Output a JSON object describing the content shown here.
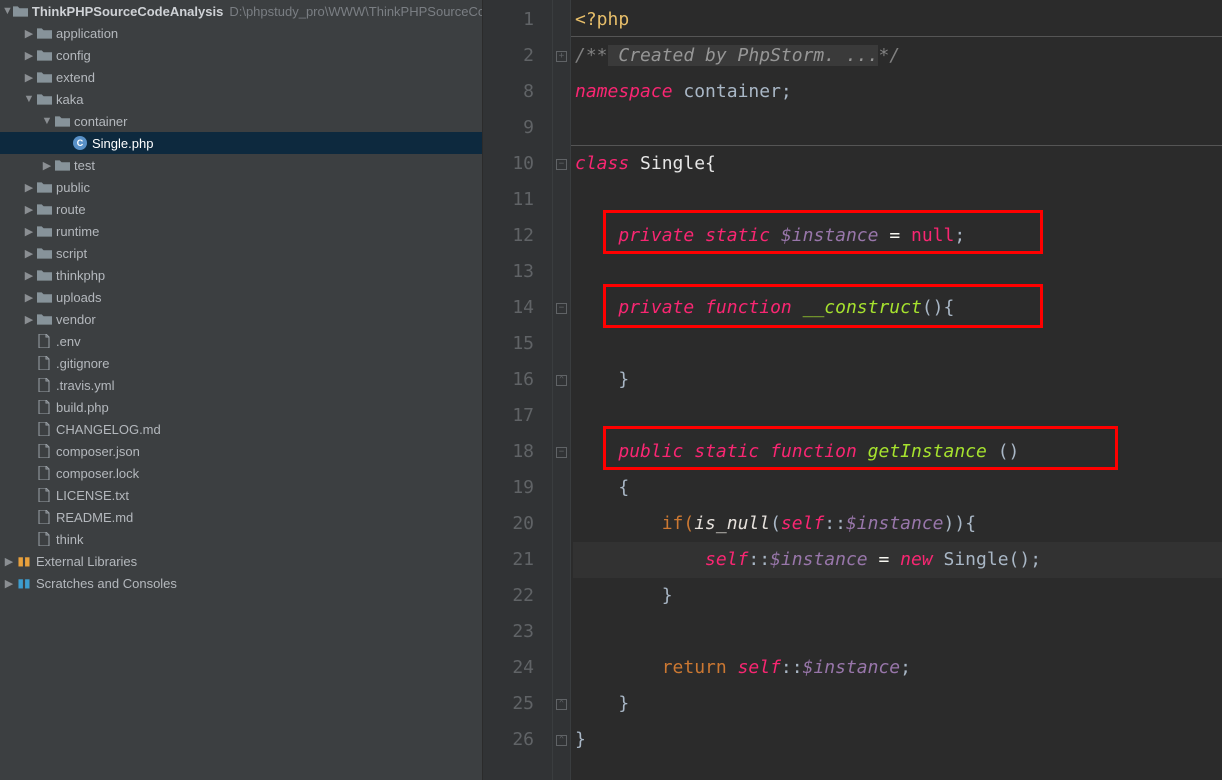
{
  "project": {
    "name": "ThinkPHPSourceCodeAnalysis",
    "path": "D:\\phpstudy_pro\\WWW\\ThinkPHPSourceCo"
  },
  "tree": [
    {
      "depth": 1,
      "arrow": "▶",
      "type": "folder",
      "label": "application"
    },
    {
      "depth": 1,
      "arrow": "▶",
      "type": "folder",
      "label": "config"
    },
    {
      "depth": 1,
      "arrow": "▶",
      "type": "folder",
      "label": "extend"
    },
    {
      "depth": 1,
      "arrow": "▼",
      "type": "folder",
      "label": "kaka"
    },
    {
      "depth": 2,
      "arrow": "▼",
      "type": "folder",
      "label": "container"
    },
    {
      "depth": 3,
      "arrow": "",
      "type": "php",
      "label": "Single.php",
      "selected": true
    },
    {
      "depth": 2,
      "arrow": "▶",
      "type": "folder",
      "label": "test"
    },
    {
      "depth": 1,
      "arrow": "▶",
      "type": "folder",
      "label": "public"
    },
    {
      "depth": 1,
      "arrow": "▶",
      "type": "folder",
      "label": "route"
    },
    {
      "depth": 1,
      "arrow": "▶",
      "type": "folder",
      "label": "runtime"
    },
    {
      "depth": 1,
      "arrow": "▶",
      "type": "folder",
      "label": "script"
    },
    {
      "depth": 1,
      "arrow": "▶",
      "type": "folder",
      "label": "thinkphp"
    },
    {
      "depth": 1,
      "arrow": "▶",
      "type": "folder",
      "label": "uploads"
    },
    {
      "depth": 1,
      "arrow": "▶",
      "type": "folder",
      "label": "vendor"
    },
    {
      "depth": 1,
      "arrow": "",
      "type": "file",
      "label": ".env"
    },
    {
      "depth": 1,
      "arrow": "",
      "type": "file",
      "label": ".gitignore"
    },
    {
      "depth": 1,
      "arrow": "",
      "type": "file",
      "label": ".travis.yml"
    },
    {
      "depth": 1,
      "arrow": "",
      "type": "file",
      "label": "build.php"
    },
    {
      "depth": 1,
      "arrow": "",
      "type": "file",
      "label": "CHANGELOG.md"
    },
    {
      "depth": 1,
      "arrow": "",
      "type": "file",
      "label": "composer.json"
    },
    {
      "depth": 1,
      "arrow": "",
      "type": "file",
      "label": "composer.lock"
    },
    {
      "depth": 1,
      "arrow": "",
      "type": "file",
      "label": "LICENSE.txt"
    },
    {
      "depth": 1,
      "arrow": "",
      "type": "file",
      "label": "README.md"
    },
    {
      "depth": 1,
      "arrow": "",
      "type": "file",
      "label": "think"
    }
  ],
  "extra": [
    {
      "icon": "ext",
      "label": "External Libraries"
    },
    {
      "icon": "scratch",
      "label": "Scratches and Consoles"
    }
  ],
  "lineNumbers": [
    "1",
    "2",
    "8",
    "9",
    "10",
    "11",
    "12",
    "13",
    "14",
    "15",
    "16",
    "17",
    "18",
    "19",
    "20",
    "21",
    "22",
    "23",
    "24",
    "25",
    "26"
  ],
  "fold": [
    "",
    "plus",
    "",
    "",
    "open",
    "",
    "",
    "",
    "open",
    "",
    "close",
    "",
    "open",
    "",
    "",
    "",
    "",
    "",
    "",
    "close",
    "close"
  ],
  "code": {
    "l1": {
      "a": "<?php"
    },
    "l2": {
      "a": "/**",
      "b": " Created by PhpStorm. ...",
      "c": "*/"
    },
    "l3": {
      "a": "namespace",
      "b": " container;"
    },
    "l5": {
      "a": "class",
      "b": " Single{"
    },
    "l7": {
      "a": "private",
      "b": "static",
      "c": "$instance",
      "d": " = ",
      "e": "null",
      "f": ";"
    },
    "l9": {
      "a": "private",
      "b": "function",
      "c": "__construct",
      "d": "(){"
    },
    "l11": {
      "a": "}"
    },
    "l13": {
      "a": "public",
      "b": "static",
      "c": "function",
      "d": "getInstance",
      "e": " ()"
    },
    "l14": {
      "a": "{"
    },
    "l15": {
      "a": "if(",
      "b": "is_null",
      "c": "(",
      "d": "self",
      "e": "::",
      "f": "$instance",
      "g": ")){"
    },
    "l16": {
      "a": "self",
      "b": "::",
      "c": "$instance",
      "d": " = ",
      "e": "new",
      "f": " Single();"
    },
    "l17": {
      "a": "}"
    },
    "l19": {
      "a": "return ",
      "b": "self",
      "c": "::",
      "d": "$instance",
      "e": ";"
    },
    "l20": {
      "a": "}"
    },
    "l21": {
      "a": "}"
    }
  }
}
